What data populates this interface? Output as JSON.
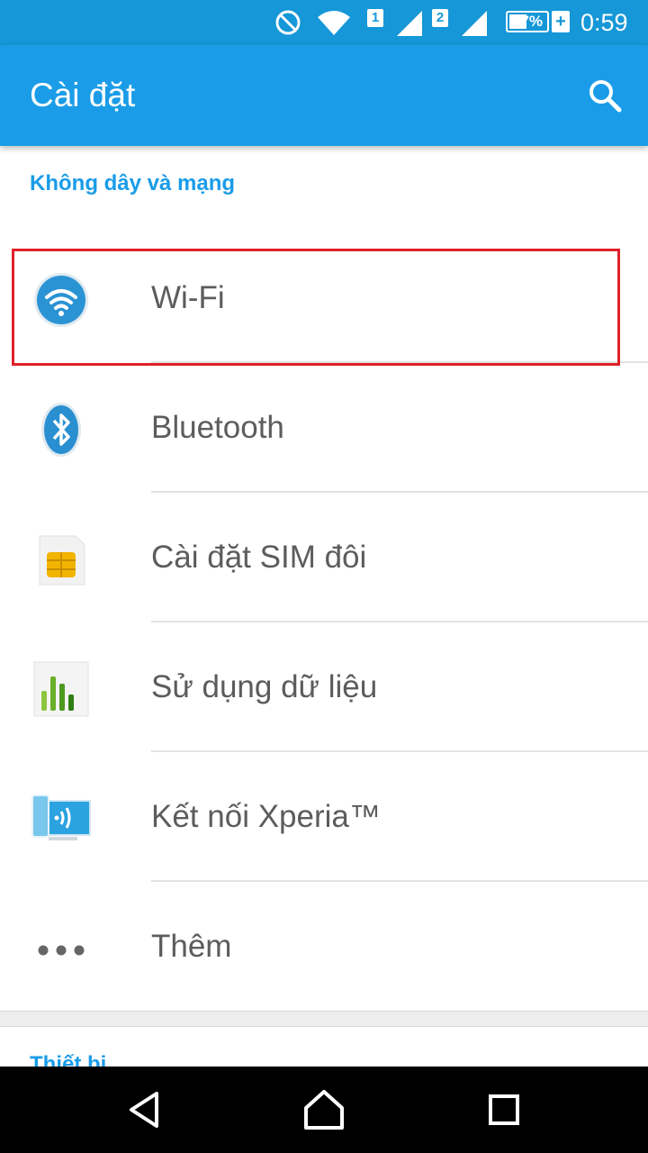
{
  "status_bar": {
    "sim1": "1",
    "sim2": "2",
    "battery_percent": "47%",
    "battery_level": 0.47,
    "charging_symbol": "+",
    "time": "0:59",
    "icons": [
      "do-not-disturb-icon",
      "wifi-signal-icon",
      "cell-signal-icon",
      "cell-signal-icon",
      "battery-icon"
    ]
  },
  "app_bar": {
    "title": "Cài đặt",
    "search_icon": "search-icon"
  },
  "sections": [
    {
      "header": "Không dây và mạng",
      "items": [
        {
          "label": "Wi-Fi",
          "icon": "wifi-icon",
          "highlighted": true
        },
        {
          "label": "Bluetooth",
          "icon": "bluetooth-icon"
        },
        {
          "label": "Cài đặt SIM đôi",
          "icon": "sim-card-icon"
        },
        {
          "label": "Sử dụng dữ liệu",
          "icon": "data-usage-icon"
        },
        {
          "label": "Kết nối Xperia™",
          "icon": "xperia-connect-icon"
        },
        {
          "label": "Thêm",
          "icon": "more-dots-icon"
        }
      ]
    },
    {
      "header": "Thiết bị"
    }
  ],
  "colors": {
    "primary": "#1a9ce8",
    "status_bar": "#1597d8",
    "highlight": "#e0202a"
  },
  "nav_bar": {
    "icons": [
      "back-icon",
      "home-icon",
      "recents-icon"
    ]
  }
}
